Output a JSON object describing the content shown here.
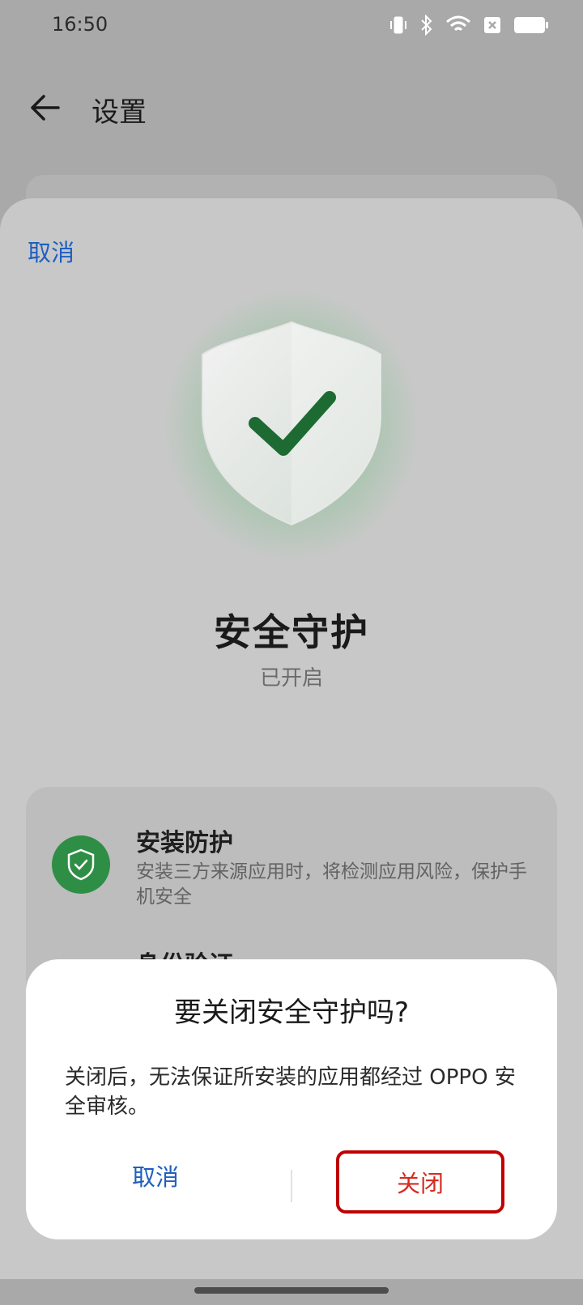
{
  "status_bar": {
    "time": "16:50"
  },
  "app_bar": {
    "title": "设置"
  },
  "sheet": {
    "cancel_label": "取消",
    "title": "安全守护",
    "status": "已开启"
  },
  "features": [
    {
      "title": "安装防护",
      "description": "安装三方来源应用时，将检测应用风险，保护手机安全",
      "icon": "shield-check-icon"
    },
    {
      "title": "身份验证"
    }
  ],
  "dialog": {
    "title": "要关闭安全守护吗?",
    "message": "关闭后，无法保证所安装的应用都经过 OPPO 安全审核。",
    "cancel_label": "取消",
    "confirm_label": "关闭"
  },
  "colors": {
    "accent": "#1f5fbf",
    "danger": "#d62a20",
    "success": "#2f8e45"
  }
}
